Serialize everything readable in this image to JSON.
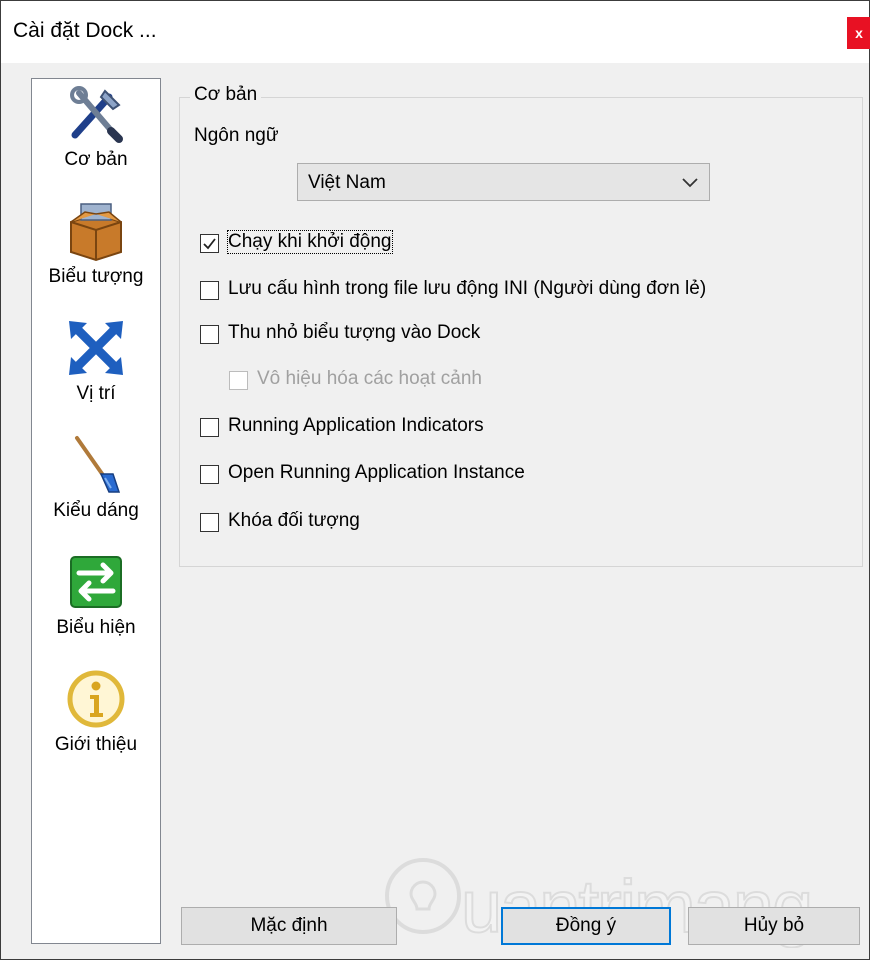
{
  "window": {
    "title": "Cài đặt Dock ...",
    "close_label": "x"
  },
  "sidebar": {
    "items": [
      {
        "label": "Cơ bản",
        "icon": "tools-icon"
      },
      {
        "label": "Biểu tượng",
        "icon": "box-icon"
      },
      {
        "label": "Vị trí",
        "icon": "position-arrows-icon"
      },
      {
        "label": "Kiểu dáng",
        "icon": "brush-icon"
      },
      {
        "label": "Biểu hiện",
        "icon": "behavior-arrows-icon"
      },
      {
        "label": "Giới thiệu",
        "icon": "info-icon"
      }
    ]
  },
  "main": {
    "group_title": "Cơ bản",
    "language_label": "Ngôn ngữ",
    "language_value": "Việt Nam",
    "options": [
      {
        "label": "Chạy khi khởi động",
        "checked": true,
        "enabled": true
      },
      {
        "label": "Lưu cấu hình trong file lưu động INI (Người dùng đơn lẻ)",
        "checked": false,
        "enabled": true
      },
      {
        "label": "Thu nhỏ biểu tượng vào Dock",
        "checked": false,
        "enabled": true
      },
      {
        "label": "Vô hiệu hóa các hoạt cảnh",
        "checked": false,
        "enabled": false
      },
      {
        "label": "Running Application Indicators",
        "checked": false,
        "enabled": true
      },
      {
        "label": "Open Running Application Instance",
        "checked": false,
        "enabled": true
      },
      {
        "label": "Khóa đối tượng",
        "checked": false,
        "enabled": true
      }
    ]
  },
  "buttons": {
    "default_label": "Mặc định",
    "ok_label": "Đồng ý",
    "cancel_label": "Hủy bỏ"
  },
  "watermark": {
    "text": "uantrimang"
  },
  "colors": {
    "close": "#e81123",
    "accent": "#0078d7",
    "icon_blue": "#1e5fbf",
    "icon_green": "#2fa83a",
    "icon_gold": "#e0b83a"
  }
}
